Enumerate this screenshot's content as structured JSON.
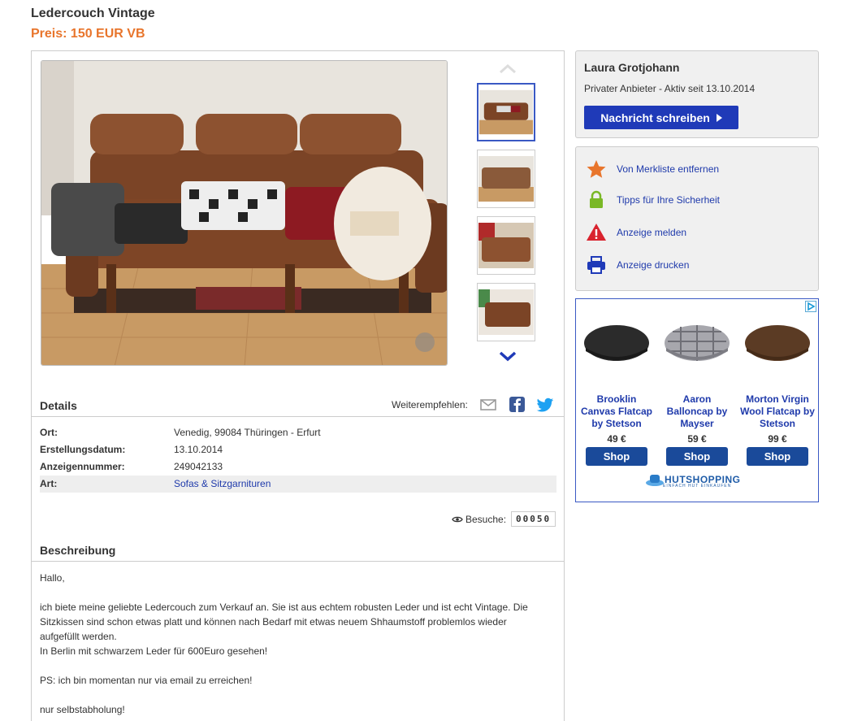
{
  "listing": {
    "title": "Ledercouch Vintage",
    "price": "Preis: 150 EUR VB"
  },
  "gallery": {
    "thumbnail_count": 4,
    "active_index": 0
  },
  "details": {
    "heading": "Details",
    "share_label": "Weiterempfehlen:",
    "rows": [
      {
        "key": "Ort:",
        "value": "Venedig, 99084 Thüringen - Erfurt"
      },
      {
        "key": "Erstellungsdatum:",
        "value": "13.10.2014"
      },
      {
        "key": "Anzeigennummer:",
        "value": "249042133"
      },
      {
        "key": "Art:",
        "value": "Sofas & Sitzgarnituren"
      }
    ],
    "visits_label": "Besuche:",
    "visits_count": "00050"
  },
  "description": {
    "heading": "Beschreibung",
    "lines": [
      "Hallo,",
      "",
      "ich biete meine geliebte Ledercouch zum Verkauf an. Sie ist aus echtem robusten Leder und ist echt Vintage. Die",
      "Sitzkissen sind schon etwas platt und können nach Bedarf mit etwas neuem Shhaumstoff problemlos wieder",
      "aufgefüllt werden.",
      "In Berlin mit schwarzem Leder für 600Euro gesehen!",
      "",
      "PS: ich bin momentan nur via email zu erreichen!",
      "",
      "nur selbstabholung!"
    ]
  },
  "seller": {
    "name": "Laura Grotjohann",
    "subtitle": "Privater Anbieter - Aktiv seit 13.10.2014",
    "message_button": "Nachricht schreiben"
  },
  "actions": [
    {
      "label": "Von Merkliste entfernen",
      "icon": "star-icon",
      "color": "#e8752c"
    },
    {
      "label": "Tipps für Ihre Sicherheit",
      "icon": "lock-icon",
      "color": "#7ab826"
    },
    {
      "label": "Anzeige melden",
      "icon": "warning-icon",
      "color": "#d9232e"
    },
    {
      "label": "Anzeige drucken",
      "icon": "printer-icon",
      "color": "#1f3ab8"
    }
  ],
  "ad": {
    "items": [
      {
        "name": "Brooklin Canvas Flatcap by Stetson",
        "price": "49 €",
        "button": "Shop",
        "color": "#2b2b2b"
      },
      {
        "name": "Aaron Balloncap by Mayser",
        "price": "59 €",
        "button": "Shop",
        "color": "#9a9aa0"
      },
      {
        "name": "Morton Virgin Wool Flatcap by Stetson",
        "price": "99 €",
        "button": "Shop",
        "color": "#5b3b24"
      }
    ],
    "brand": "HUTSHOPPING",
    "brand_tagline": "EINFACH HUT EINKAUFEN"
  },
  "colors": {
    "accent_orange": "#e8752c",
    "primary_blue": "#1f3ab8",
    "link_blue": "#1f3aab"
  }
}
